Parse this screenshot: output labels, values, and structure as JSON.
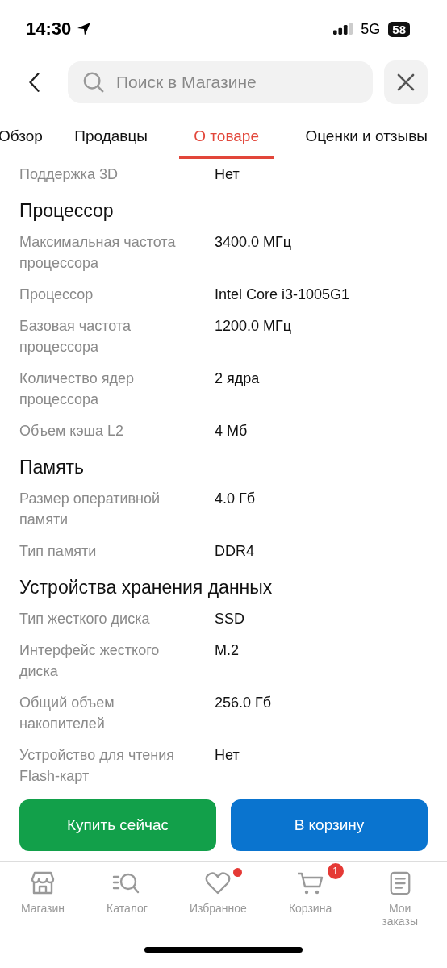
{
  "status_bar": {
    "time": "14:30",
    "network": "5G",
    "battery": "58"
  },
  "search": {
    "placeholder": "Поиск в Магазине"
  },
  "tabs": [
    {
      "label": "Обзор",
      "selected": false
    },
    {
      "label": "Продавцы",
      "selected": false
    },
    {
      "label": "О товаре",
      "selected": true
    },
    {
      "label": "Оценки и отзывы",
      "selected": false
    }
  ],
  "sections": [
    {
      "rows": [
        {
          "label": "Поддержка 3D",
          "value": "Нет"
        }
      ]
    },
    {
      "title": "Процессор",
      "rows": [
        {
          "label": "Максимальная частота процессора",
          "value": "3400.0 МГц"
        },
        {
          "label": "Процессор",
          "value": "Intel Core i3-1005G1"
        },
        {
          "label": "Базовая частота процессора",
          "value": "1200.0 МГц"
        },
        {
          "label": "Количество ядер процессора",
          "value": "2 ядра"
        },
        {
          "label": "Объем кэша L2",
          "value": "4 Мб"
        }
      ]
    },
    {
      "title": "Память",
      "rows": [
        {
          "label": "Размер оперативной памяти",
          "value": "4.0 Гб"
        },
        {
          "label": "Тип памяти",
          "value": "DDR4"
        }
      ]
    },
    {
      "title": "Устройства хранения данных",
      "rows": [
        {
          "label": "Тип жесткого диска",
          "value": "SSD"
        },
        {
          "label": "Интерфейс жесткого диска",
          "value": "M.2"
        },
        {
          "label": "Общий объем накопителей",
          "value": "256.0 Гб"
        },
        {
          "label": "Устройство для чтения Flash-карт",
          "value": "Нет"
        }
      ]
    }
  ],
  "actions": [
    {
      "label": "Купить сейчас",
      "kind": "buy"
    },
    {
      "label": "В корзину",
      "kind": "cart"
    }
  ],
  "nav": [
    {
      "label": "Магазин",
      "kind": "store",
      "dot": false
    },
    {
      "label": "Каталог",
      "kind": "catalog",
      "dot": false
    },
    {
      "label": "Избранное",
      "kind": "favorites",
      "dot": true
    },
    {
      "label": "Корзина",
      "kind": "cart",
      "dot": false,
      "badge": "1"
    },
    {
      "label": "Мои заказы",
      "kind": "orders",
      "dot": false
    }
  ]
}
